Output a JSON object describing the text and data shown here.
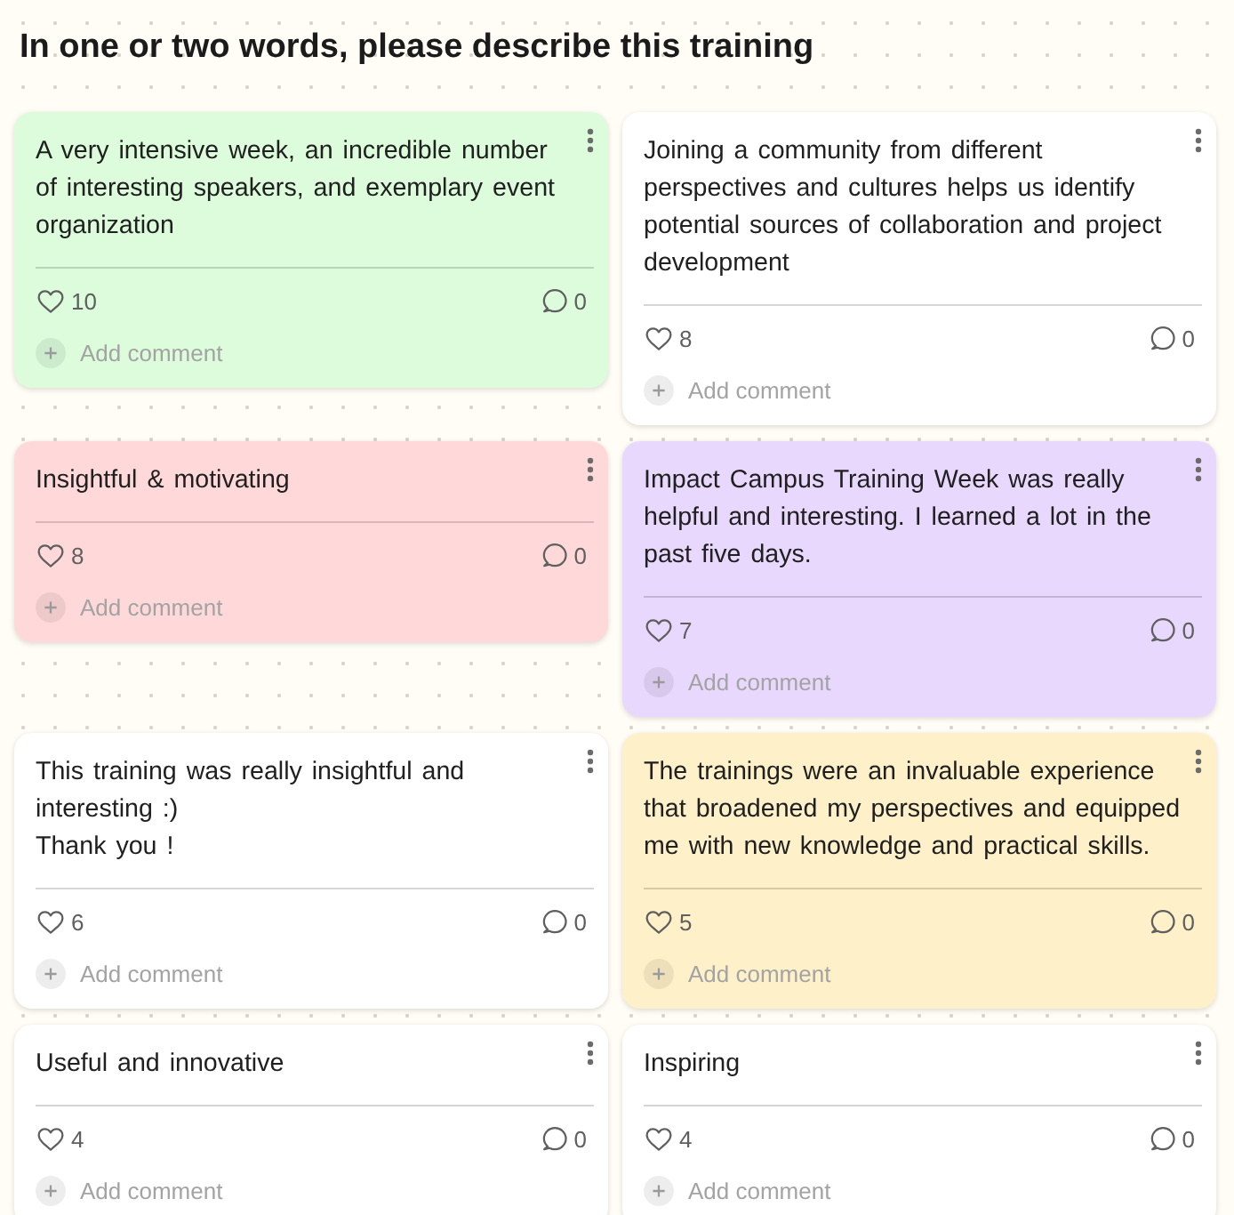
{
  "title": "In one or two words, please describe this training",
  "posts": [
    {
      "text": "A very intensive week, an incredible number of interesting speakers, and exemplary event organization",
      "color": "#dcfcdc",
      "likes": "10",
      "comments": "0",
      "add_comment": "Add comment"
    },
    {
      "text": "Joining a community from different perspectives and cultures helps us identify potential sources of collaboration and project development",
      "color": "#ffffff",
      "likes": "8",
      "comments": "0",
      "add_comment": "Add comment"
    },
    {
      "text": "Insightful & motivating",
      "color": "#ffd9d9",
      "likes": "8",
      "comments": "0",
      "add_comment": "Add comment"
    },
    {
      "text": "Impact Campus Training Week was really helpful and interesting. I learned a lot in the past five days.",
      "color": "#e9d8fd",
      "likes": "7",
      "comments": "0",
      "add_comment": "Add comment"
    },
    {
      "text": "This training was really insightful and interesting :)\nThank you !",
      "color": "#ffffff",
      "likes": "6",
      "comments": "0",
      "add_comment": "Add comment"
    },
    {
      "text": "The trainings were an invaluable experience that broadened my perspectives and equipped me with new knowledge and practical skills.",
      "color": "#fef0c8",
      "likes": "5",
      "comments": "0",
      "add_comment": "Add comment"
    },
    {
      "text": "Useful and innovative",
      "color": "#ffffff",
      "likes": "4",
      "comments": "0",
      "add_comment": "Add comment"
    },
    {
      "text": "Inspiring",
      "color": "#ffffff",
      "likes": "4",
      "comments": "0",
      "add_comment": "Add comment"
    }
  ]
}
